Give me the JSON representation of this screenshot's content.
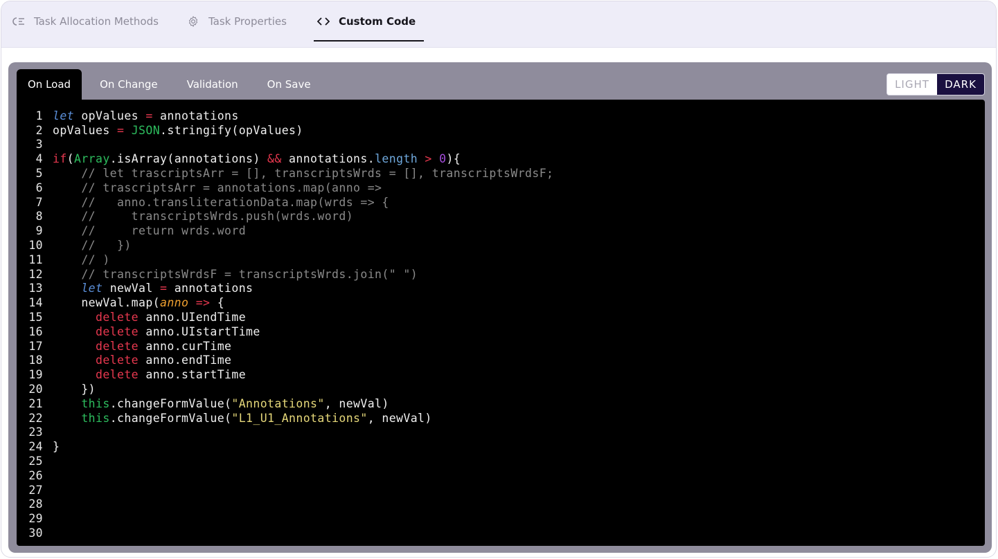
{
  "top_tabs": [
    {
      "label": "Task Allocation Methods",
      "icon": "list-check-icon",
      "active": false
    },
    {
      "label": "Task Properties",
      "icon": "gear-icon",
      "active": false
    },
    {
      "label": "Custom Code",
      "icon": "code-brackets-icon",
      "active": true
    }
  ],
  "editor_tabs": [
    {
      "label": "On Load",
      "active": true
    },
    {
      "label": "On Change",
      "active": false
    },
    {
      "label": "Validation",
      "active": false
    },
    {
      "label": "On Save",
      "active": false
    }
  ],
  "theme_toggle": {
    "light": "LIGHT",
    "dark": "DARK",
    "selected": "DARK"
  },
  "colors": {
    "accent_dark": "#1a1040",
    "editor_bg": "#000000",
    "panel_bg": "#8f8c9c",
    "keyword_red": "#e8384f",
    "keyword_green": "#2dbd5e",
    "string_yellow": "#e6d87a",
    "comment_gray": "#8a8a8a"
  },
  "code": {
    "line_numbers": [
      "1",
      "2",
      "3",
      "4",
      "5",
      "6",
      "7",
      "8",
      "9",
      "10",
      "11",
      "12",
      "13",
      "14",
      "15",
      "16",
      "17",
      "18",
      "19",
      "20",
      "21",
      "22",
      "23",
      "24",
      "25",
      "26",
      "27",
      "28",
      "29",
      "30"
    ],
    "lines": [
      [
        [
          "kw-let",
          "let"
        ],
        [
          "",
          "​ opValues "
        ],
        [
          "op",
          "="
        ],
        [
          "",
          " annotations"
        ]
      ],
      [
        [
          "",
          "opValues "
        ],
        [
          "op",
          "="
        ],
        [
          "",
          " "
        ],
        [
          "green",
          "JSON"
        ],
        [
          "",
          ".stringify(opValues)"
        ]
      ],
      [],
      [
        [
          "red",
          "if"
        ],
        [
          "",
          "("
        ],
        [
          "green",
          "Array"
        ],
        [
          "",
          ".isArray(annotations) "
        ],
        [
          "op",
          "&&"
        ],
        [
          "",
          " annotations."
        ],
        [
          "blue",
          "length"
        ],
        [
          "",
          " "
        ],
        [
          "op",
          ">"
        ],
        [
          "",
          " "
        ],
        [
          "purple",
          "0"
        ],
        [
          "",
          "){"
        ]
      ],
      [
        [
          "",
          "    "
        ],
        [
          "cmt",
          "// let trascriptsArr = [], transcriptsWrds = [], transcriptsWrdsF;"
        ]
      ],
      [
        [
          "",
          "    "
        ],
        [
          "cmt",
          "// trascriptsArr = annotations.map(anno =>"
        ]
      ],
      [
        [
          "",
          "    "
        ],
        [
          "cmt",
          "//   anno.transliterationData.map(wrds => {"
        ]
      ],
      [
        [
          "",
          "    "
        ],
        [
          "cmt",
          "//     transcriptsWrds.push(wrds.word)"
        ]
      ],
      [
        [
          "",
          "    "
        ],
        [
          "cmt",
          "//     return wrds.word"
        ]
      ],
      [
        [
          "",
          "    "
        ],
        [
          "cmt",
          "//   })"
        ]
      ],
      [
        [
          "",
          "    "
        ],
        [
          "cmt",
          "// )"
        ]
      ],
      [
        [
          "",
          "    "
        ],
        [
          "cmt",
          "// transcriptsWrdsF = transcriptsWrds.join(\" \")"
        ]
      ],
      [
        [
          "",
          "    "
        ],
        [
          "kw-let",
          "let"
        ],
        [
          "",
          " newVal "
        ],
        [
          "op",
          "="
        ],
        [
          "",
          " annotations"
        ]
      ],
      [
        [
          "",
          "    newVal.map("
        ],
        [
          "param",
          "anno"
        ],
        [
          "",
          " "
        ],
        [
          "op",
          "=>"
        ],
        [
          "",
          " {"
        ]
      ],
      [
        [
          "",
          "      "
        ],
        [
          "red",
          "delete"
        ],
        [
          "",
          " anno.UIendTime"
        ]
      ],
      [
        [
          "",
          "      "
        ],
        [
          "red",
          "delete"
        ],
        [
          "",
          " anno.UIstartTime"
        ]
      ],
      [
        [
          "",
          "      "
        ],
        [
          "red",
          "delete"
        ],
        [
          "",
          " anno.curTime"
        ]
      ],
      [
        [
          "",
          "      "
        ],
        [
          "red",
          "delete"
        ],
        [
          "",
          " anno.endTime"
        ]
      ],
      [
        [
          "",
          "      "
        ],
        [
          "red",
          "delete"
        ],
        [
          "",
          " anno.startTime"
        ]
      ],
      [
        [
          "",
          "    })"
        ]
      ],
      [
        [
          "",
          "    "
        ],
        [
          "green",
          "this"
        ],
        [
          "",
          ".changeFormValue("
        ],
        [
          "str",
          "\"Annotations\""
        ],
        [
          "",
          ", newVal)"
        ]
      ],
      [
        [
          "",
          "    "
        ],
        [
          "green",
          "this"
        ],
        [
          "",
          ".changeFormValue("
        ],
        [
          "str",
          "\"L1_U1_Annotations\""
        ],
        [
          "",
          ", newVal)"
        ]
      ],
      [],
      [
        [
          "",
          "}"
        ]
      ],
      [],
      [],
      [],
      [],
      [],
      []
    ]
  }
}
